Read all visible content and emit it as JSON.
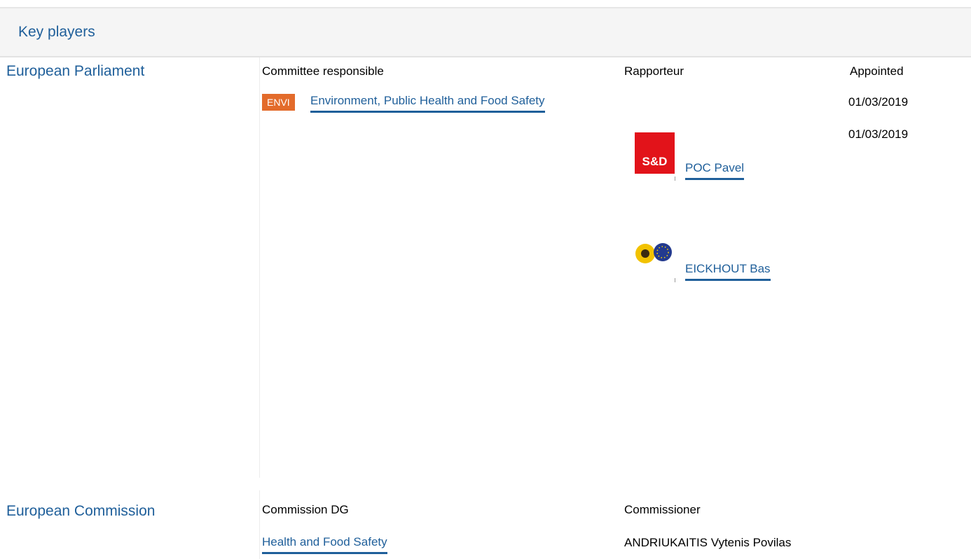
{
  "header": {
    "title": "Key players"
  },
  "parliament": {
    "label": "European Parliament",
    "columns": {
      "committee": "Committee responsible",
      "rapporteur": "Rapporteur",
      "appointed": "Appointed"
    },
    "committee": {
      "badge": "ENVI",
      "name": "Environment, Public Health and Food Safety",
      "appointed": "01/03/2019"
    },
    "rapporteurs": [
      {
        "party_logo": "S&D",
        "name": "POC Pavel",
        "appointed": "01/03/2019"
      },
      {
        "party_logo": "greens-efa-logo",
        "name": "EICKHOUT Bas"
      }
    ]
  },
  "commission": {
    "label": "European Commission",
    "columns": {
      "dg": "Commission DG",
      "commissioner": "Commissioner"
    },
    "dg": "Health and Food Safety",
    "commissioner": "ANDRIUKAITIS Vytenis Povilas"
  },
  "colors": {
    "link": "#1f5f9a",
    "badge": "#e36b2b",
    "sd_red": "#e2131a"
  }
}
